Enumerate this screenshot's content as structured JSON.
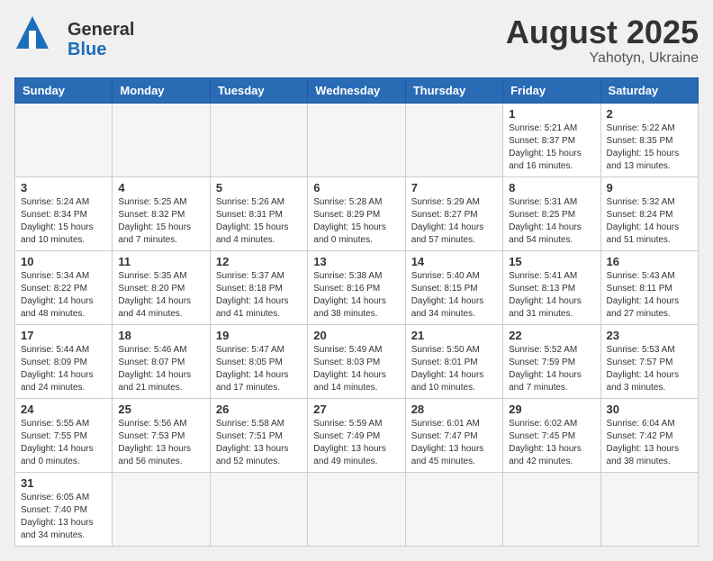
{
  "header": {
    "logo_general": "General",
    "logo_blue": "Blue",
    "month_year": "August 2025",
    "location": "Yahotyn, Ukraine"
  },
  "weekdays": [
    "Sunday",
    "Monday",
    "Tuesday",
    "Wednesday",
    "Thursday",
    "Friday",
    "Saturday"
  ],
  "weeks": [
    [
      {
        "day": "",
        "info": ""
      },
      {
        "day": "",
        "info": ""
      },
      {
        "day": "",
        "info": ""
      },
      {
        "day": "",
        "info": ""
      },
      {
        "day": "",
        "info": ""
      },
      {
        "day": "1",
        "info": "Sunrise: 5:21 AM\nSunset: 8:37 PM\nDaylight: 15 hours and 16 minutes."
      },
      {
        "day": "2",
        "info": "Sunrise: 5:22 AM\nSunset: 8:35 PM\nDaylight: 15 hours and 13 minutes."
      }
    ],
    [
      {
        "day": "3",
        "info": "Sunrise: 5:24 AM\nSunset: 8:34 PM\nDaylight: 15 hours and 10 minutes."
      },
      {
        "day": "4",
        "info": "Sunrise: 5:25 AM\nSunset: 8:32 PM\nDaylight: 15 hours and 7 minutes."
      },
      {
        "day": "5",
        "info": "Sunrise: 5:26 AM\nSunset: 8:31 PM\nDaylight: 15 hours and 4 minutes."
      },
      {
        "day": "6",
        "info": "Sunrise: 5:28 AM\nSunset: 8:29 PM\nDaylight: 15 hours and 0 minutes."
      },
      {
        "day": "7",
        "info": "Sunrise: 5:29 AM\nSunset: 8:27 PM\nDaylight: 14 hours and 57 minutes."
      },
      {
        "day": "8",
        "info": "Sunrise: 5:31 AM\nSunset: 8:25 PM\nDaylight: 14 hours and 54 minutes."
      },
      {
        "day": "9",
        "info": "Sunrise: 5:32 AM\nSunset: 8:24 PM\nDaylight: 14 hours and 51 minutes."
      }
    ],
    [
      {
        "day": "10",
        "info": "Sunrise: 5:34 AM\nSunset: 8:22 PM\nDaylight: 14 hours and 48 minutes."
      },
      {
        "day": "11",
        "info": "Sunrise: 5:35 AM\nSunset: 8:20 PM\nDaylight: 14 hours and 44 minutes."
      },
      {
        "day": "12",
        "info": "Sunrise: 5:37 AM\nSunset: 8:18 PM\nDaylight: 14 hours and 41 minutes."
      },
      {
        "day": "13",
        "info": "Sunrise: 5:38 AM\nSunset: 8:16 PM\nDaylight: 14 hours and 38 minutes."
      },
      {
        "day": "14",
        "info": "Sunrise: 5:40 AM\nSunset: 8:15 PM\nDaylight: 14 hours and 34 minutes."
      },
      {
        "day": "15",
        "info": "Sunrise: 5:41 AM\nSunset: 8:13 PM\nDaylight: 14 hours and 31 minutes."
      },
      {
        "day": "16",
        "info": "Sunrise: 5:43 AM\nSunset: 8:11 PM\nDaylight: 14 hours and 27 minutes."
      }
    ],
    [
      {
        "day": "17",
        "info": "Sunrise: 5:44 AM\nSunset: 8:09 PM\nDaylight: 14 hours and 24 minutes."
      },
      {
        "day": "18",
        "info": "Sunrise: 5:46 AM\nSunset: 8:07 PM\nDaylight: 14 hours and 21 minutes."
      },
      {
        "day": "19",
        "info": "Sunrise: 5:47 AM\nSunset: 8:05 PM\nDaylight: 14 hours and 17 minutes."
      },
      {
        "day": "20",
        "info": "Sunrise: 5:49 AM\nSunset: 8:03 PM\nDaylight: 14 hours and 14 minutes."
      },
      {
        "day": "21",
        "info": "Sunrise: 5:50 AM\nSunset: 8:01 PM\nDaylight: 14 hours and 10 minutes."
      },
      {
        "day": "22",
        "info": "Sunrise: 5:52 AM\nSunset: 7:59 PM\nDaylight: 14 hours and 7 minutes."
      },
      {
        "day": "23",
        "info": "Sunrise: 5:53 AM\nSunset: 7:57 PM\nDaylight: 14 hours and 3 minutes."
      }
    ],
    [
      {
        "day": "24",
        "info": "Sunrise: 5:55 AM\nSunset: 7:55 PM\nDaylight: 14 hours and 0 minutes."
      },
      {
        "day": "25",
        "info": "Sunrise: 5:56 AM\nSunset: 7:53 PM\nDaylight: 13 hours and 56 minutes."
      },
      {
        "day": "26",
        "info": "Sunrise: 5:58 AM\nSunset: 7:51 PM\nDaylight: 13 hours and 52 minutes."
      },
      {
        "day": "27",
        "info": "Sunrise: 5:59 AM\nSunset: 7:49 PM\nDaylight: 13 hours and 49 minutes."
      },
      {
        "day": "28",
        "info": "Sunrise: 6:01 AM\nSunset: 7:47 PM\nDaylight: 13 hours and 45 minutes."
      },
      {
        "day": "29",
        "info": "Sunrise: 6:02 AM\nSunset: 7:45 PM\nDaylight: 13 hours and 42 minutes."
      },
      {
        "day": "30",
        "info": "Sunrise: 6:04 AM\nSunset: 7:42 PM\nDaylight: 13 hours and 38 minutes."
      }
    ],
    [
      {
        "day": "31",
        "info": "Sunrise: 6:05 AM\nSunset: 7:40 PM\nDaylight: 13 hours and 34 minutes."
      },
      {
        "day": "",
        "info": ""
      },
      {
        "day": "",
        "info": ""
      },
      {
        "day": "",
        "info": ""
      },
      {
        "day": "",
        "info": ""
      },
      {
        "day": "",
        "info": ""
      },
      {
        "day": "",
        "info": ""
      }
    ]
  ]
}
